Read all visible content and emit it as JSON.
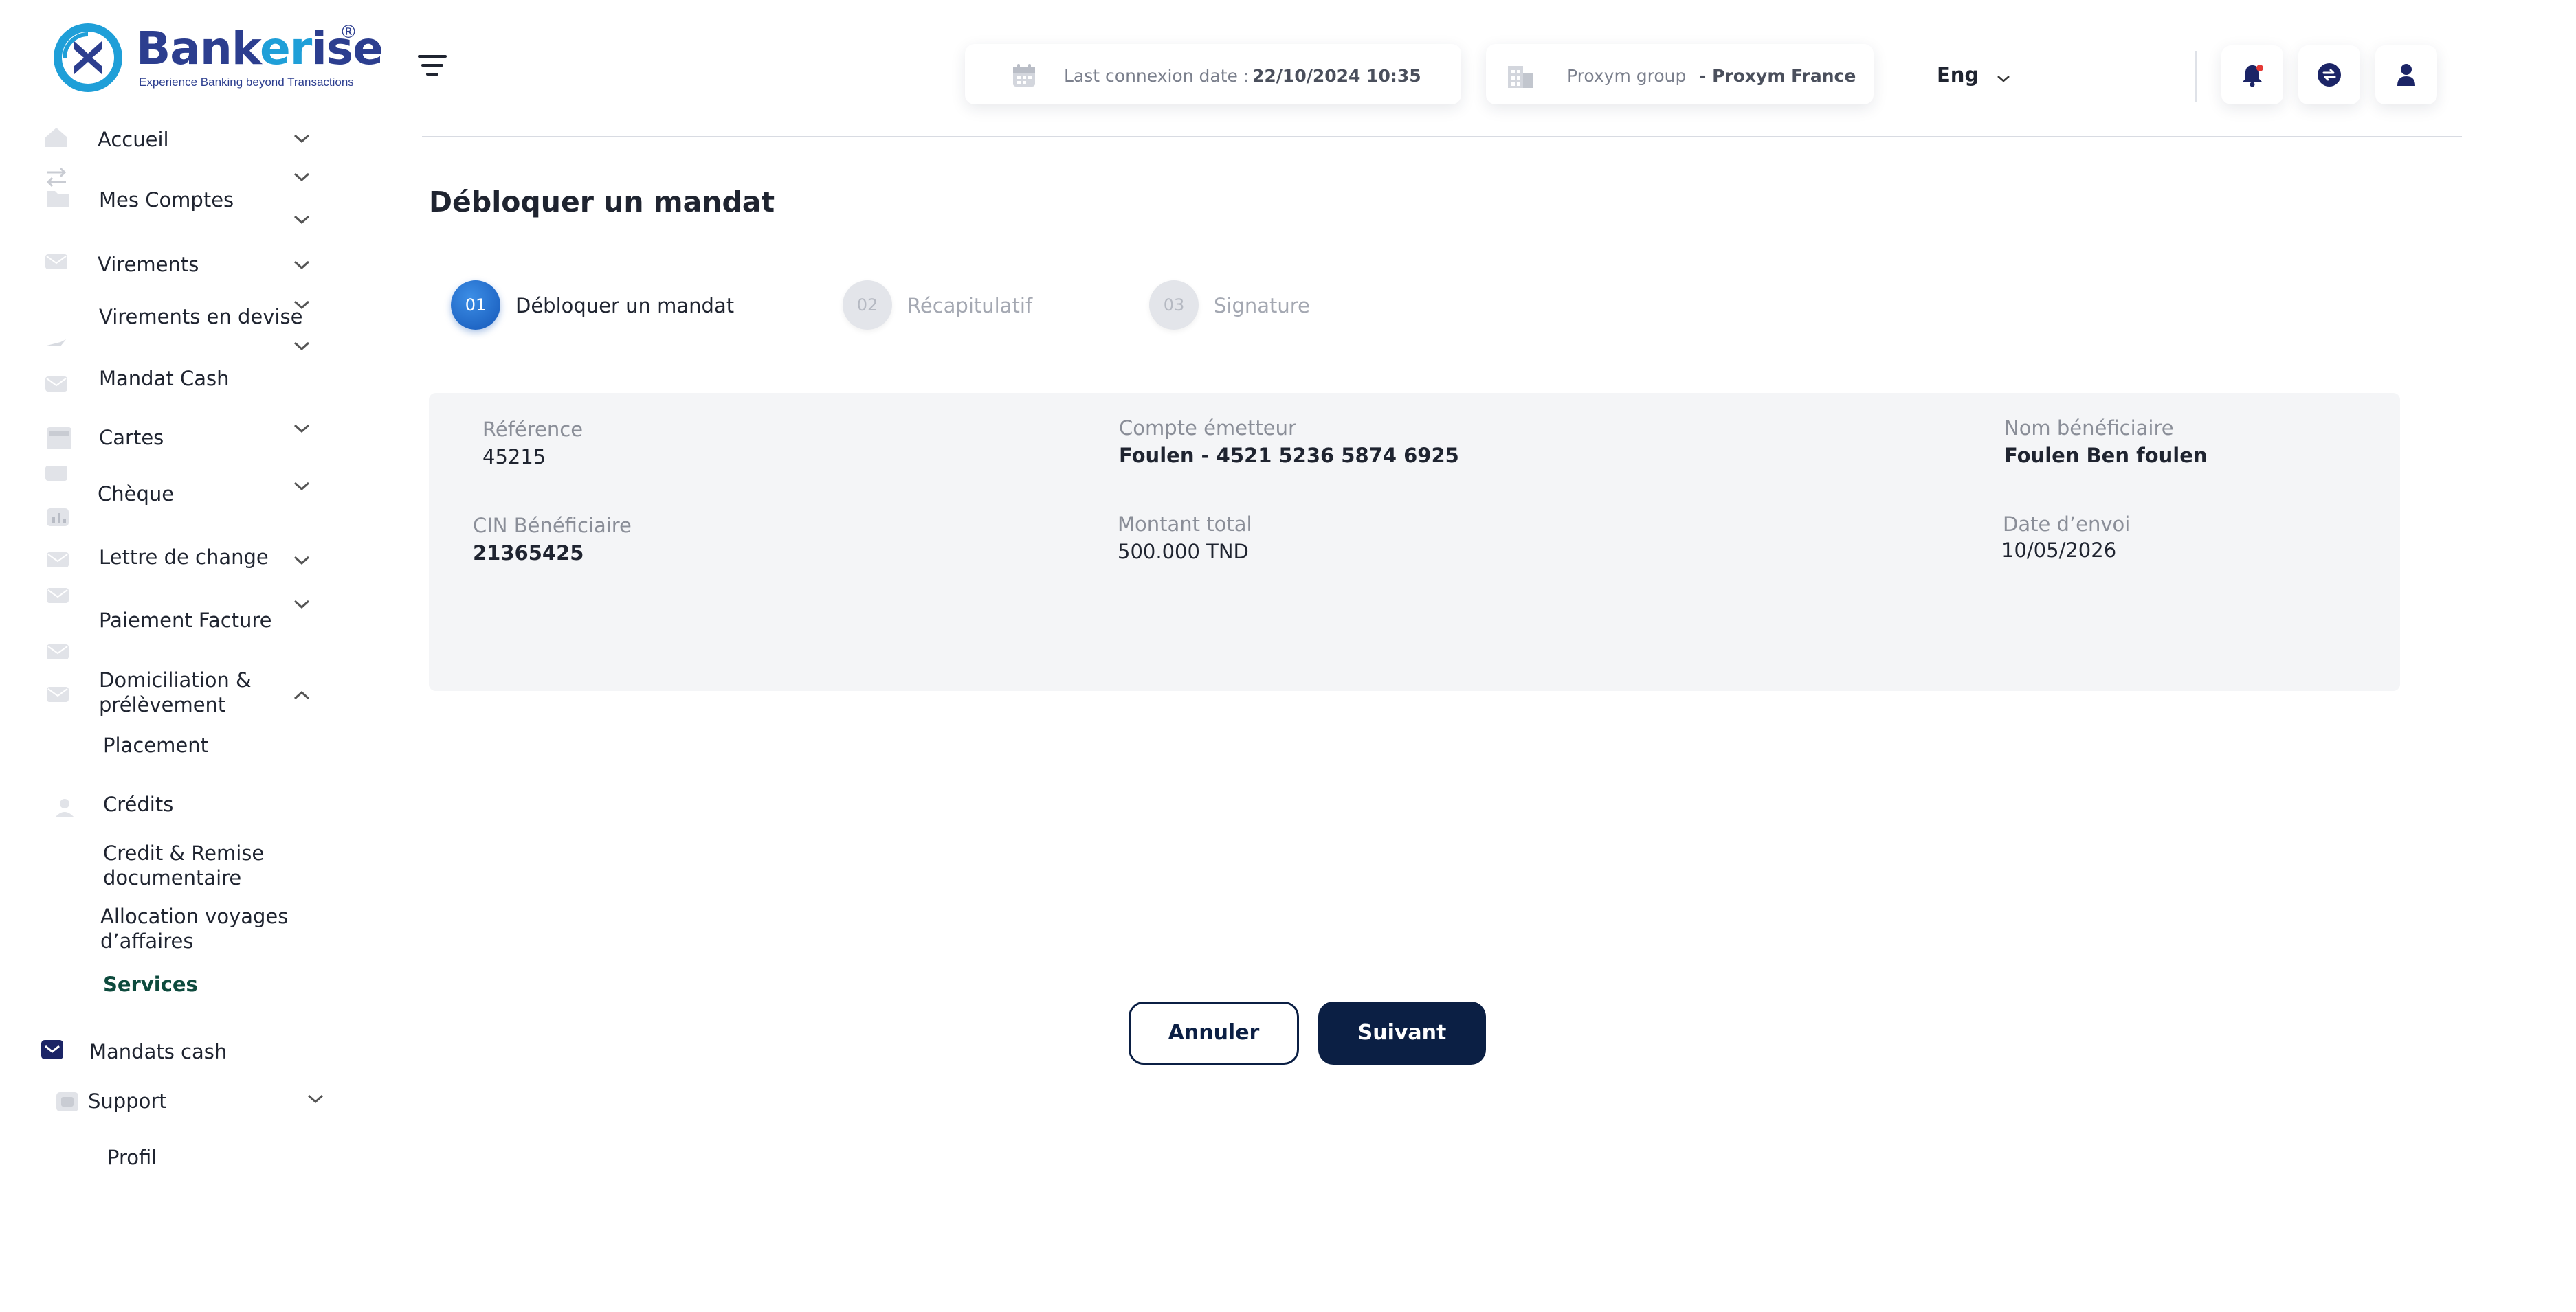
{
  "brand": {
    "name_prefix": "Bank",
    "name_accent": "er",
    "name_suffix": "ise",
    "registered": "®",
    "tagline": "Experience Banking beyond Transactions",
    "colors": {
      "primary": "#2c3e8f",
      "accent": "#1f9fd8",
      "dark_button": "#0b1f44",
      "step_active": "#1f6fd0"
    }
  },
  "sidebar": {
    "items": [
      {
        "label": "Accueil",
        "icon": "home-icon"
      },
      {
        "label": "Mes Comptes",
        "icon": "folder-icon"
      },
      {
        "label": "Virements",
        "icon": "mail-icon"
      },
      {
        "label": "Virements en devise",
        "icon": "transfer-icon"
      },
      {
        "label": "Mandat Cash",
        "icon": "mail-icon"
      },
      {
        "label": "Cartes",
        "icon": "card-icon"
      },
      {
        "label": "Chèque",
        "icon": "mail-icon"
      },
      {
        "label": "Lettre de change",
        "icon": "mail-icon"
      },
      {
        "label": "Paiement Facture",
        "icon": "mail-icon"
      },
      {
        "label": "Domiciliation & prélèvement",
        "icon": "mail-icon"
      },
      {
        "label": "Placement",
        "icon": "chart-icon"
      },
      {
        "label": "Crédits",
        "icon": "user-icon"
      },
      {
        "label": "Credit & Remise documentaire",
        "icon": ""
      },
      {
        "label": "Allocation  voyages d’affaires",
        "icon": ""
      },
      {
        "label": "Services",
        "icon": ""
      },
      {
        "label": "Mandats cash",
        "icon": "mail-icon"
      },
      {
        "label": "Support",
        "icon": "support-icon"
      },
      {
        "label": "Profil",
        "icon": ""
      }
    ]
  },
  "topbar": {
    "last_connexion_label": "Last connexion date :",
    "last_connexion_value": "22/10/2024 10:35",
    "group_label": "Proxym group",
    "group_value": "- Proxym France",
    "language": "Eng"
  },
  "page": {
    "title": "Débloquer un mandat",
    "steps": [
      {
        "number": "01",
        "label": "Débloquer un mandat",
        "state": "active"
      },
      {
        "number": "02",
        "label": "Récapitulatif",
        "state": "inactive"
      },
      {
        "number": "03",
        "label": "Signature",
        "state": "inactive"
      }
    ],
    "summary": {
      "reference_label": "Référence",
      "reference_value": "45215",
      "compte_label": "Compte émetteur",
      "compte_value": "Foulen - 4521 5236 5874 6925",
      "beneficiaire_label": "Nom bénéficiaire",
      "beneficiaire_value": "Foulen Ben foulen",
      "cin_label": "CIN Bénéficiaire",
      "cin_value": "21365425",
      "montant_label": "Montant total",
      "montant_value": "500.000 TND",
      "date_label": "Date d’envoi",
      "date_value": "10/05/2026"
    },
    "buttons": {
      "cancel": "Annuler",
      "next": "Suivant"
    }
  }
}
